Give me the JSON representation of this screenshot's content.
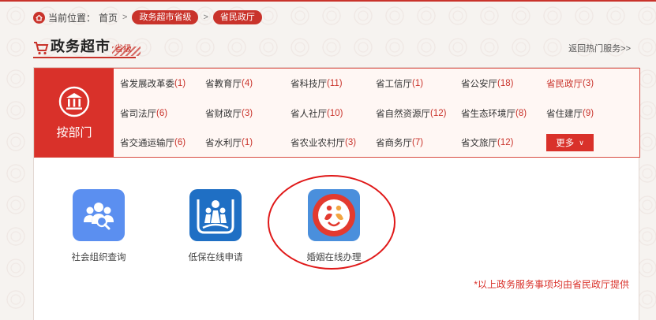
{
  "breadcrumb": {
    "prefix": "当前位置：",
    "home": "首页",
    "level": "政务超市省级",
    "current": "省民政厅"
  },
  "header": {
    "title": "政务超市",
    "level": "省级",
    "back_link": "返回热门服务>>"
  },
  "departments": {
    "side_label": "按部门",
    "items": [
      {
        "name": "省发展改革委",
        "count": "(1)"
      },
      {
        "name": "省教育厅",
        "count": "(4)"
      },
      {
        "name": "省科技厅",
        "count": "(11)"
      },
      {
        "name": "省工信厅",
        "count": "(1)"
      },
      {
        "name": "省公安厅",
        "count": "(18)"
      },
      {
        "name": "省民政厅",
        "count": "(3)",
        "active": true
      },
      {
        "name": "省司法厅",
        "count": "(6)"
      },
      {
        "name": "省财政厅",
        "count": "(3)"
      },
      {
        "name": "省人社厅",
        "count": "(10)"
      },
      {
        "name": "省自然资源厅",
        "count": "(12)"
      },
      {
        "name": "省生态环境厅",
        "count": "(8)"
      },
      {
        "name": "省住建厅",
        "count": "(9)"
      },
      {
        "name": "省交通运输厅",
        "count": "(6)"
      },
      {
        "name": "省水利厅",
        "count": "(1)"
      },
      {
        "name": "省农业农村厅",
        "count": "(3)"
      },
      {
        "name": "省商务厅",
        "count": "(7)"
      },
      {
        "name": "省文旅厅",
        "count": "(12)"
      }
    ],
    "more_label": "更多"
  },
  "services": [
    {
      "label": "社会组织查询",
      "icon": "people-search-icon",
      "color": "#5b8ff0"
    },
    {
      "label": "低保在线申请",
      "icon": "family-shelter-icon",
      "color": "#1f6fc4"
    },
    {
      "label": "婚姻在线办理",
      "icon": "marriage-emblem-icon",
      "color": "#e33a2f"
    }
  ],
  "footnote": "*以上政务服务事项均由省民政厅提供",
  "colors": {
    "accent": "#c9332b",
    "highlight_ring": "#e01818"
  }
}
